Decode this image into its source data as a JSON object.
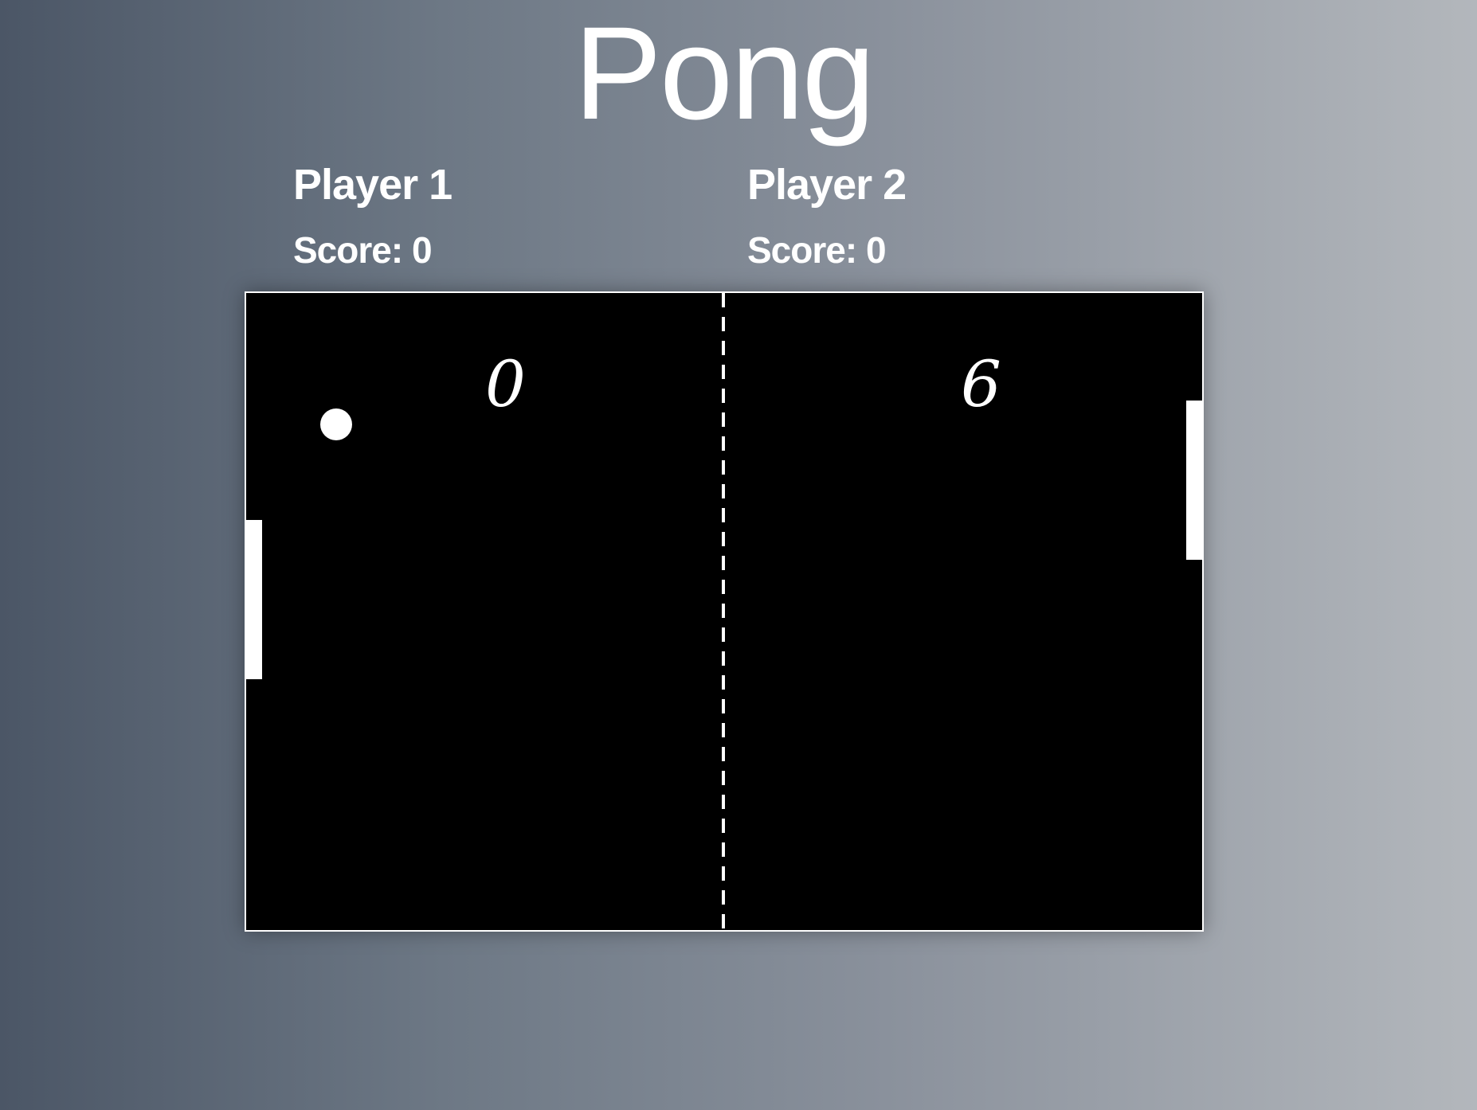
{
  "title": "Pong",
  "players": [
    {
      "name": "Player 1",
      "score_label": "Score: 0"
    },
    {
      "name": "Player 2",
      "score_label": "Score: 0"
    }
  ],
  "court": {
    "left_score": "0",
    "right_score": "6"
  },
  "colors": {
    "court_background": "#000000",
    "foreground": "#ffffff"
  }
}
